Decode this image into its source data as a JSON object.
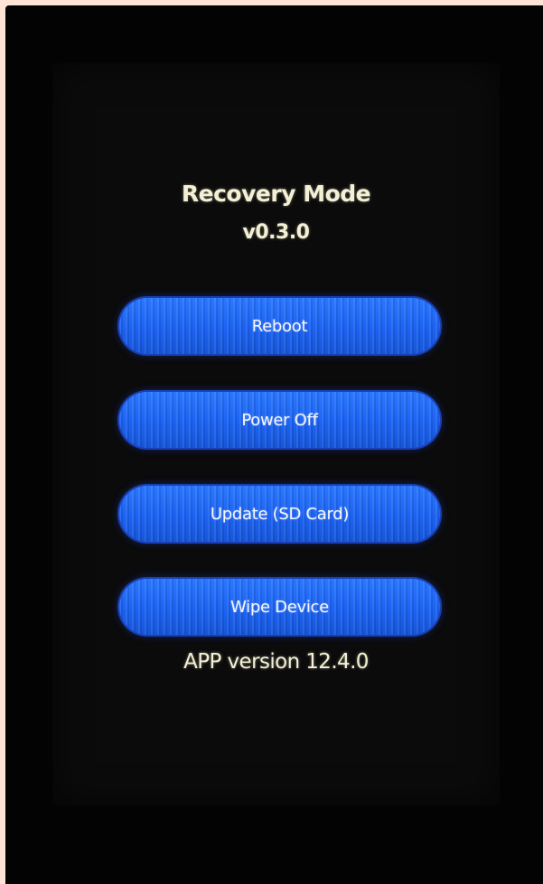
{
  "screen": {
    "title": "Recovery Mode",
    "version": "v0.3.0"
  },
  "menu": {
    "reboot_label": "Reboot",
    "power_off_label": "Power Off",
    "update_label": "Update (SD Card)",
    "wipe_label": "Wipe Device"
  },
  "footer": {
    "app_version": "APP version 12.4.0"
  },
  "colors": {
    "background": "#030303",
    "button_blue": "#1f6bf7",
    "text_cream": "#f3f0d6"
  }
}
